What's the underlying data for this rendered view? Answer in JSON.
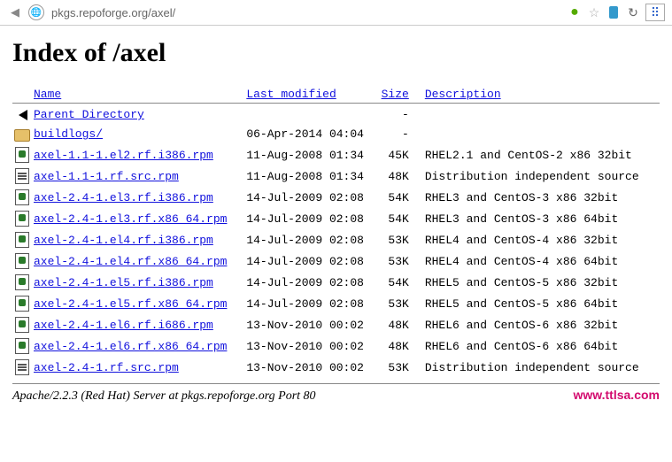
{
  "browser": {
    "url": "pkgs.repoforge.org/axel/"
  },
  "page": {
    "title": "Index of /axel"
  },
  "headers": {
    "name": "Name",
    "modified": "Last modified",
    "size": "Size",
    "description": "Description"
  },
  "rows": [
    {
      "icon": "back",
      "name": "Parent Directory",
      "modified": "",
      "size": "-",
      "desc": ""
    },
    {
      "icon": "folder",
      "name": " buildlogs/",
      "modified": "06-Apr-2014 04:04",
      "size": "-",
      "desc": ""
    },
    {
      "icon": "pkg",
      "name": "axel-1.1-1.el2.rf.i386.rpm",
      "modified": "11-Aug-2008 01:34",
      "size": "45K",
      "desc": "RHEL2.1 and CentOS-2 x86 32bit"
    },
    {
      "icon": "src",
      "name": "axel-1.1-1.rf.src.rpm",
      "modified": "11-Aug-2008 01:34",
      "size": "48K",
      "desc": "Distribution independent source"
    },
    {
      "icon": "pkg",
      "name": "axel-2.4-1.el3.rf.i386.rpm",
      "modified": "14-Jul-2009 02:08",
      "size": "54K",
      "desc": "RHEL3 and CentOS-3 x86 32bit"
    },
    {
      "icon": "pkg",
      "name": "axel-2.4-1.el3.rf.x86 64.rpm",
      "modified": "14-Jul-2009 02:08",
      "size": "54K",
      "desc": "RHEL3 and CentOS-3 x86 64bit"
    },
    {
      "icon": "pkg",
      "name": "axel-2.4-1.el4.rf.i386.rpm",
      "modified": "14-Jul-2009 02:08",
      "size": "53K",
      "desc": "RHEL4 and CentOS-4 x86 32bit"
    },
    {
      "icon": "pkg",
      "name": "axel-2.4-1.el4.rf.x86 64.rpm",
      "modified": "14-Jul-2009 02:08",
      "size": "53K",
      "desc": "RHEL4 and CentOS-4 x86 64bit"
    },
    {
      "icon": "pkg",
      "name": "axel-2.4-1.el5.rf.i386.rpm",
      "modified": "14-Jul-2009 02:08",
      "size": "54K",
      "desc": "RHEL5 and CentOS-5 x86 32bit"
    },
    {
      "icon": "pkg",
      "name": "axel-2.4-1.el5.rf.x86 64.rpm",
      "modified": "14-Jul-2009 02:08",
      "size": "53K",
      "desc": "RHEL5 and CentOS-5 x86 64bit"
    },
    {
      "icon": "pkg",
      "name": "axel-2.4-1.el6.rf.i686.rpm",
      "modified": "13-Nov-2010 00:02",
      "size": "48K",
      "desc": "RHEL6 and CentOS-6 x86 32bit"
    },
    {
      "icon": "pkg",
      "name": "axel-2.4-1.el6.rf.x86 64.rpm",
      "modified": "13-Nov-2010 00:02",
      "size": "48K",
      "desc": "RHEL6 and CentOS-6 x86 64bit"
    },
    {
      "icon": "src",
      "name": "axel-2.4-1.rf.src.rpm",
      "modified": "13-Nov-2010 00:02",
      "size": "53K",
      "desc": "Distribution independent source"
    }
  ],
  "footer": {
    "server": "Apache/2.2.3 (Red Hat) Server at pkgs.repoforge.org Port 80",
    "watermark": "www.ttlsa.com"
  }
}
